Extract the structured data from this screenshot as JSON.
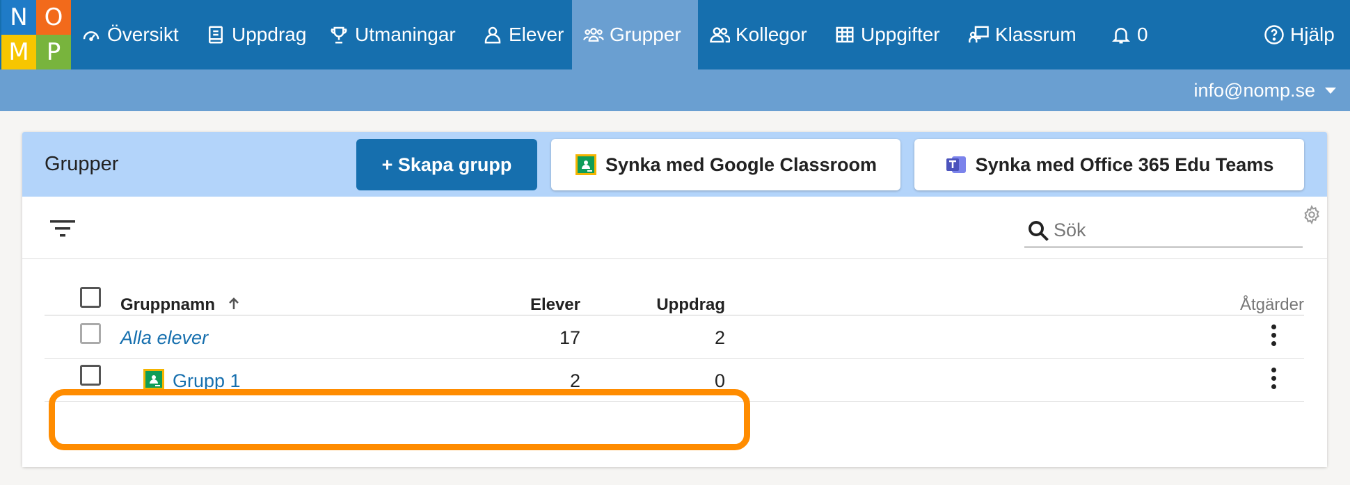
{
  "logo": {
    "letters": [
      "N",
      "O",
      "M",
      "P"
    ],
    "colors": [
      "#1f7bc7",
      "#f26a1b",
      "#f7c600",
      "#78b43d"
    ]
  },
  "nav": {
    "items": [
      {
        "label": "Översikt",
        "icon": "speedometer-icon"
      },
      {
        "label": "Uppdrag",
        "icon": "book-icon"
      },
      {
        "label": "Utmaningar",
        "icon": "trophy-icon"
      },
      {
        "label": "Elever",
        "icon": "person-icon"
      },
      {
        "label": "Grupper",
        "icon": "people-icon",
        "active": true
      },
      {
        "label": "Kollegor",
        "icon": "people-outline-icon"
      },
      {
        "label": "Uppgifter",
        "icon": "grid-icon"
      },
      {
        "label": "Klassrum",
        "icon": "classroom-icon"
      },
      {
        "label": "0",
        "icon": "bell-icon"
      },
      {
        "label": "Hjälp",
        "icon": "help-circle-icon"
      }
    ]
  },
  "account": {
    "email": "info@nomp.se"
  },
  "page": {
    "title": "Grupper",
    "create_button": "+ Skapa grupp",
    "google_button": "Synka med Google Classroom",
    "teams_button": "Synka med Office 365 Edu Teams"
  },
  "search": {
    "placeholder": "Sök",
    "value": ""
  },
  "table": {
    "headers": {
      "name": "Gruppnamn",
      "students": "Elever",
      "assignments": "Uppdrag",
      "actions": "Åtgärder"
    },
    "rows": [
      {
        "name": "Alla elever",
        "students": "17",
        "assignments": "2",
        "italic": true
      },
      {
        "name": "Grupp 1",
        "students": "2",
        "assignments": "0",
        "google": true
      }
    ]
  },
  "colors": {
    "nav": "#166fae",
    "subbar": "#6a9fd1",
    "header": "#b3d4fa",
    "highlight": "#ff8c00"
  }
}
